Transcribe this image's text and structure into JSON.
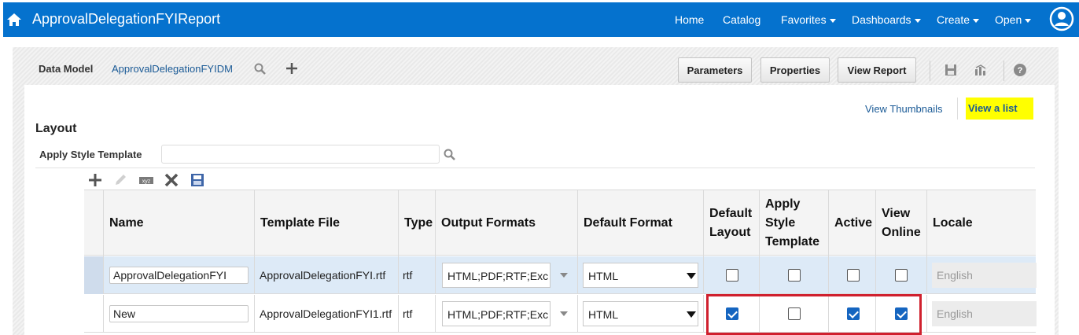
{
  "header": {
    "title": "ApprovalDelegationFYIReport",
    "nav": [
      {
        "label": "Home",
        "has_caret": false
      },
      {
        "label": "Catalog",
        "has_caret": false
      },
      {
        "label": "Favorites",
        "has_caret": true
      },
      {
        "label": "Dashboards",
        "has_caret": true
      },
      {
        "label": "Create",
        "has_caret": true
      },
      {
        "label": "Open",
        "has_caret": true
      }
    ]
  },
  "toolbar": {
    "data_model_label": "Data Model",
    "data_model_value": "ApprovalDelegationFYIDM",
    "parameters_label": "Parameters",
    "properties_label": "Properties",
    "view_report_label": "View Report"
  },
  "view_links": {
    "thumbnails": "View Thumbnails",
    "list": "View a list"
  },
  "layout": {
    "heading": "Layout",
    "apply_style_label": "Apply Style Template",
    "apply_style_value": ""
  },
  "table": {
    "headers": {
      "name": "Name",
      "template_file": "Template File",
      "type": "Type",
      "output_formats": "Output Formats",
      "default_format": "Default Format",
      "default_layout": "Default Layout",
      "apply_style_template": "Apply Style Template",
      "active": "Active",
      "view_online": "View Online",
      "locale": "Locale"
    },
    "rows": [
      {
        "name": "ApprovalDelegationFYI",
        "template_file": "ApprovalDelegationFYI.rtf",
        "type": "rtf",
        "output_formats": "HTML;PDF;RTF;Exc",
        "default_format": "HTML",
        "default_layout": false,
        "apply_style_template": false,
        "active": false,
        "view_online": false,
        "locale": "English"
      },
      {
        "name": "New",
        "template_file": "ApprovalDelegationFYI1.rtf",
        "type": "rtf",
        "output_formats": "HTML;PDF;RTF;Exc",
        "default_format": "HTML",
        "default_layout": true,
        "apply_style_template": false,
        "active": true,
        "view_online": true,
        "locale": "English"
      }
    ]
  },
  "colors": {
    "brand_bar": "#0572ce",
    "link": "#1a5a96",
    "highlight": "#ffff00",
    "checkbox_checked": "#1565c0",
    "annotation_box": "#d0202e",
    "selected_row": "#ddeaf7"
  },
  "icons": [
    "home-icon",
    "user-avatar-icon",
    "search-icon",
    "plus-icon",
    "save-icon",
    "chart-icon",
    "help-icon",
    "edit-icon",
    "xyz-icon",
    "delete-icon",
    "generate-icon"
  ]
}
